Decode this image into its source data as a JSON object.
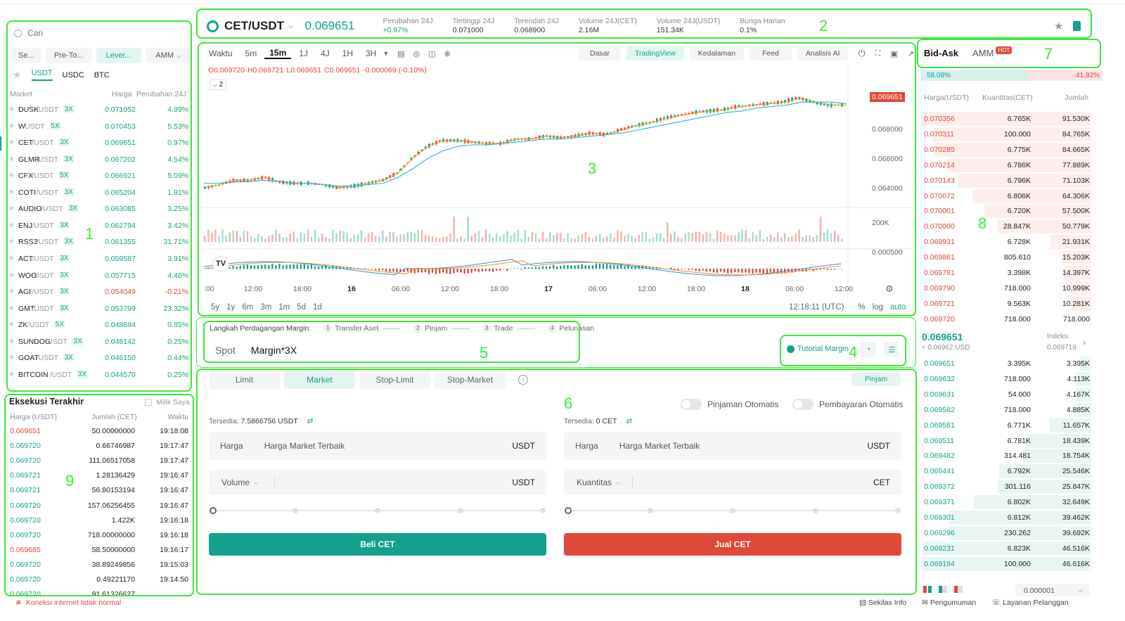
{
  "search": {
    "placeholder": "Cari"
  },
  "market_tabs": [
    "Se...",
    "Pre-To...",
    "Lever...",
    "AMM"
  ],
  "quote_tabs": [
    "USDT",
    "USDC",
    "BTC"
  ],
  "market_headers": {
    "market": "Market",
    "price": "Harga",
    "change": "Perubahan 24J"
  },
  "markets": [
    {
      "base": "DUSK",
      "quote": "/USDT",
      "lev": "3X",
      "price": "0.071052",
      "change": "4.99%",
      "dir": "up"
    },
    {
      "base": "W",
      "quote": "/USDT",
      "lev": "5X",
      "price": "0.070453",
      "change": "5.53%",
      "dir": "up"
    },
    {
      "base": "CET",
      "quote": "/USDT",
      "lev": "3X",
      "price": "0.069651",
      "change": "0.97%",
      "dir": "up"
    },
    {
      "base": "GLMR",
      "quote": "/USDT",
      "lev": "3X",
      "price": "0.067202",
      "change": "4.54%",
      "dir": "up"
    },
    {
      "base": "CFX",
      "quote": "/USDT",
      "lev": "5X",
      "price": "0.066921",
      "change": "5.09%",
      "dir": "up"
    },
    {
      "base": "COTI",
      "quote": "/USDT",
      "lev": "3X",
      "price": "0.065204",
      "change": "1.91%",
      "dir": "up"
    },
    {
      "base": "AUDIO",
      "quote": "/USDT",
      "lev": "3X",
      "price": "0.063085",
      "change": "3.25%",
      "dir": "up"
    },
    {
      "base": "ENJ",
      "quote": "/USDT",
      "lev": "3X",
      "price": "0.062794",
      "change": "3.42%",
      "dir": "up"
    },
    {
      "base": "RSS3",
      "quote": "/USDT",
      "lev": "3X",
      "price": "0.061355",
      "change": "31.71%",
      "dir": "up"
    },
    {
      "base": "ACT",
      "quote": "/USDT",
      "lev": "3X",
      "price": "0.059587",
      "change": "3.91%",
      "dir": "up"
    },
    {
      "base": "WOO",
      "quote": "/USDT",
      "lev": "3X",
      "price": "0.057715",
      "change": "4.46%",
      "dir": "up"
    },
    {
      "base": "AGI",
      "quote": "/USDT",
      "lev": "3X",
      "price": "0.054049",
      "change": "-0.21%",
      "dir": "down"
    },
    {
      "base": "GMT",
      "quote": "/USDT",
      "lev": "3X",
      "price": "0.053799",
      "change": "23.32%",
      "dir": "up"
    },
    {
      "base": "ZK",
      "quote": "/USDT",
      "lev": "5X",
      "price": "0.048694",
      "change": "0.85%",
      "dir": "up"
    },
    {
      "base": "SUNDOG",
      "quote": "/USDT",
      "lev": "3X",
      "price": "0.048142",
      "change": "0.25%",
      "dir": "up"
    },
    {
      "base": "GOAT",
      "quote": "/USDT",
      "lev": "3X",
      "price": "0.046150",
      "change": "0.44%",
      "dir": "up"
    },
    {
      "base": "BITCOIN",
      "quote": "/USDT",
      "lev": "3X",
      "price": "0.044570",
      "change": "0.25%",
      "dir": "up"
    }
  ],
  "ticker": {
    "pair": "CET/USDT",
    "price": "0.069651",
    "stats": [
      {
        "label": "Perubahan 24J",
        "value": "+0.97%",
        "green": true
      },
      {
        "label": "Tertinggi 24J",
        "value": "0.071000",
        "green": false
      },
      {
        "label": "Terendah 24J",
        "value": "0.068900",
        "green": false
      },
      {
        "label": "Volume 24J(CET)",
        "value": "2.16M",
        "green": false
      },
      {
        "label": "Volume 24J(USDT)",
        "value": "151.34K",
        "green": false
      },
      {
        "label": "Bunga Harian",
        "value": "0.1%",
        "green": false
      }
    ]
  },
  "chart_toolbar": {
    "intervals": [
      "Waktu",
      "5m",
      "15m",
      "1J",
      "4J",
      "1H",
      "3H"
    ],
    "active_interval": "15m",
    "views": [
      "Dasar",
      "TradingView",
      "Kedalaman",
      "Feed",
      "Analisis AI"
    ],
    "active_view": "TradingView"
  },
  "ohlc": {
    "o": "O0.069720",
    "h": "H0.069721",
    "l": "L0.069651",
    "c": "C0.069651",
    "chg": "-0.000069 (-0.10%)",
    "indicator_count": "2"
  },
  "chart_axes": {
    "y_ticks": [
      "0.070000",
      "0.068000",
      "0.066000",
      "0.064000"
    ],
    "current_price_tag": "0.069651",
    "vol_tick": "200K",
    "macd_tick": "0.000500",
    "x_ticks": [
      ":00",
      "12:00",
      "18:00",
      "16",
      "06:00",
      "12:00",
      "18:00",
      "17",
      "06:00",
      "12:00",
      "18:00",
      "18",
      "06:00",
      "12:00"
    ],
    "ranges": [
      "5y",
      "1y",
      "6m",
      "3m",
      "1m",
      "5d",
      "1d"
    ],
    "clock": "12:18:11 (UTC)",
    "scale_opts": [
      "%",
      "log",
      "auto"
    ]
  },
  "chart_data": {
    "type": "line",
    "title": "",
    "xlabel": "",
    "ylabel": "",
    "ylim": [
      0.0628,
      0.071
    ],
    "series": [
      {
        "values": [
          0.064,
          0.0642,
          0.0645,
          0.0645,
          0.0647,
          0.0644,
          0.0643,
          0.0643,
          0.0642,
          0.064,
          0.0641,
          0.0643,
          0.0645,
          0.065,
          0.066,
          0.0668,
          0.0672,
          0.0672,
          0.0671,
          0.067,
          0.067,
          0.0673,
          0.0673,
          0.0675,
          0.0674,
          0.0675,
          0.0677,
          0.0676,
          0.0679,
          0.0682,
          0.0684,
          0.0687,
          0.0689,
          0.0691,
          0.0692,
          0.0693,
          0.0695,
          0.0696,
          0.0697,
          0.0698,
          0.0701,
          0.0698,
          0.0696,
          0.0696
        ]
      },
      {
        "values": [
          0.0643,
          0.0643,
          0.0644,
          0.0644,
          0.0645,
          0.0644,
          0.0643,
          0.0643,
          0.0642,
          0.0641,
          0.0641,
          0.0642,
          0.0643,
          0.0647,
          0.0653,
          0.066,
          0.0665,
          0.0668,
          0.0669,
          0.0669,
          0.067,
          0.0671,
          0.0672,
          0.0673,
          0.0673,
          0.0674,
          0.0675,
          0.0676,
          0.0677,
          0.0679,
          0.0681,
          0.0683,
          0.0685,
          0.0687,
          0.0689,
          0.0691,
          0.0692,
          0.0694,
          0.0695,
          0.0696,
          0.0698,
          0.0698,
          0.0698,
          0.0697
        ]
      }
    ]
  },
  "margin_steps": {
    "title": "Langkah Perdagangan Margin:",
    "steps": [
      "Transfer Aset",
      "Pinjam",
      "Trade",
      "Pelunasan"
    ]
  },
  "account_tabs": [
    "Spot",
    "Margin*3X"
  ],
  "tutorial_label": "Tutorial Margin",
  "order_types": [
    "Limit",
    "Market",
    "Stop-Limit",
    "Stop-Market"
  ],
  "active_order_type": "Market",
  "pinjam_btn": "Pinjam",
  "auto_toggles": [
    "Pinjaman Otomatis",
    "Pembayaran Otomatis"
  ],
  "buy": {
    "avail_label": "Tersedia:",
    "avail_value": "7.5866756 USDT",
    "price_label": "Harga",
    "price_value": "Harga Market Terbaik",
    "price_unit": "USDT",
    "amt_label": "Volume",
    "amt_unit": "USDT",
    "button": "Beli CET"
  },
  "sell": {
    "avail_label": "Tersedia:",
    "avail_value": "0 CET",
    "price_label": "Harga",
    "price_value": "Harga Market Terbaik",
    "price_unit": "USDT",
    "amt_label": "Kuantitas",
    "amt_unit": "CET",
    "button": "Jual CET"
  },
  "orderbook": {
    "tabs": [
      "Bid-Ask",
      "AMM"
    ],
    "hot": "HOT",
    "ratio_buy": "58.08%",
    "ratio_sell": "41.92%",
    "headers": [
      "Harga(USDT)",
      "Kuantitas(CET)",
      "Jumlah"
    ],
    "asks": [
      {
        "p": "0.070356",
        "q": "6.765K",
        "t": "91.530K",
        "d": 1.0
      },
      {
        "p": "0.070311",
        "q": "100.000",
        "t": "84.765K",
        "d": 0.93
      },
      {
        "p": "0.070285",
        "q": "6.775K",
        "t": "84.665K",
        "d": 0.92
      },
      {
        "p": "0.070214",
        "q": "6.786K",
        "t": "77.889K",
        "d": 0.85
      },
      {
        "p": "0.070143",
        "q": "6.796K",
        "t": "71.103K",
        "d": 0.78
      },
      {
        "p": "0.070072",
        "q": "6.806K",
        "t": "64.306K",
        "d": 0.7
      },
      {
        "p": "0.070001",
        "q": "6.720K",
        "t": "57.500K",
        "d": 0.63
      },
      {
        "p": "0.070000",
        "q": "28.847K",
        "t": "50.779K",
        "d": 0.55
      },
      {
        "p": "0.069931",
        "q": "6.728K",
        "t": "21.931K",
        "d": 0.24
      },
      {
        "p": "0.069861",
        "q": "805.610",
        "t": "15.203K",
        "d": 0.17
      },
      {
        "p": "0.069791",
        "q": "3.398K",
        "t": "14.397K",
        "d": 0.16
      },
      {
        "p": "0.069790",
        "q": "718.000",
        "t": "10.999K",
        "d": 0.12
      },
      {
        "p": "0.069721",
        "q": "9.563K",
        "t": "10.281K",
        "d": 0.11
      },
      {
        "p": "0.069720",
        "q": "718.000",
        "t": "718.000",
        "d": 0.01
      }
    ],
    "last_price": "0.069651",
    "last_usd": "≈ 0.06962 USD",
    "index_label": "Indeks:",
    "index_value": "0.069719",
    "bids": [
      {
        "p": "0.069651",
        "q": "3.395K",
        "t": "3.395K",
        "d": 0.07
      },
      {
        "p": "0.069632",
        "q": "718.000",
        "t": "4.113K",
        "d": 0.09
      },
      {
        "p": "0.069631",
        "q": "54.000",
        "t": "4.167K",
        "d": 0.09
      },
      {
        "p": "0.069582",
        "q": "718.000",
        "t": "4.885K",
        "d": 0.1
      },
      {
        "p": "0.069581",
        "q": "6.771K",
        "t": "11.657K",
        "d": 0.25
      },
      {
        "p": "0.069511",
        "q": "6.781K",
        "t": "18.439K",
        "d": 0.39
      },
      {
        "p": "0.069482",
        "q": "314.481",
        "t": "18.754K",
        "d": 0.4
      },
      {
        "p": "0.069441",
        "q": "6.792K",
        "t": "25.546K",
        "d": 0.54
      },
      {
        "p": "0.069372",
        "q": "301.116",
        "t": "25.847K",
        "d": 0.55
      },
      {
        "p": "0.069371",
        "q": "6.802K",
        "t": "32.649K",
        "d": 0.69
      },
      {
        "p": "0.069301",
        "q": "6.812K",
        "t": "39.462K",
        "d": 0.84
      },
      {
        "p": "0.069296",
        "q": "230.262",
        "t": "39.692K",
        "d": 0.84
      },
      {
        "p": "0.069231",
        "q": "6.823K",
        "t": "46.516K",
        "d": 0.99
      },
      {
        "p": "0.069194",
        "q": "100.000",
        "t": "46.616K",
        "d": 1.0
      }
    ],
    "precision": "0.000001"
  },
  "trades": {
    "title": "Eksekusi Terakhir",
    "mine": "Milik Saya",
    "headers": [
      "Harga (USDT)",
      "Jumlah (CET)",
      "Waktu"
    ],
    "rows": [
      {
        "p": "0.069651",
        "a": "50.00000000",
        "t": "19:18:08",
        "dir": "down"
      },
      {
        "p": "0.069720",
        "a": "0.66746987",
        "t": "19:17:47",
        "dir": "up"
      },
      {
        "p": "0.069720",
        "a": "111.06517058",
        "t": "19:17:47",
        "dir": "up"
      },
      {
        "p": "0.069721",
        "a": "1.28136429",
        "t": "19:16:47",
        "dir": "up"
      },
      {
        "p": "0.069721",
        "a": "56.80153194",
        "t": "19:16:47",
        "dir": "up"
      },
      {
        "p": "0.069720",
        "a": "157.06256455",
        "t": "19:16:47",
        "dir": "up"
      },
      {
        "p": "0.069720",
        "a": "1.422K",
        "t": "19:16:18",
        "dir": "up"
      },
      {
        "p": "0.069720",
        "a": "718.00000000",
        "t": "19:16:18",
        "dir": "up"
      },
      {
        "p": "0.069685",
        "a": "58.50000000",
        "t": "19:16:17",
        "dir": "down"
      },
      {
        "p": "0.069720",
        "a": "38.89249856",
        "t": "19:15:03",
        "dir": "up"
      },
      {
        "p": "0.069720",
        "a": "0.49221170",
        "t": "19:14:50",
        "dir": "up"
      },
      {
        "p": "0.069720",
        "a": "91.61326627",
        "t": "",
        "dir": "up"
      }
    ]
  },
  "status_bar": {
    "warning": "Koneksi internet tidak normal",
    "links": [
      "Sekilas Info",
      "Pengumuman",
      "Layanan Pelanggan"
    ]
  },
  "annotations": [
    "1",
    "2",
    "3",
    "4",
    "5",
    "6",
    "7",
    "8",
    "9"
  ],
  "colors": {
    "green": "#14a08c",
    "red": "#e0483a",
    "highlight": "#39e839"
  }
}
